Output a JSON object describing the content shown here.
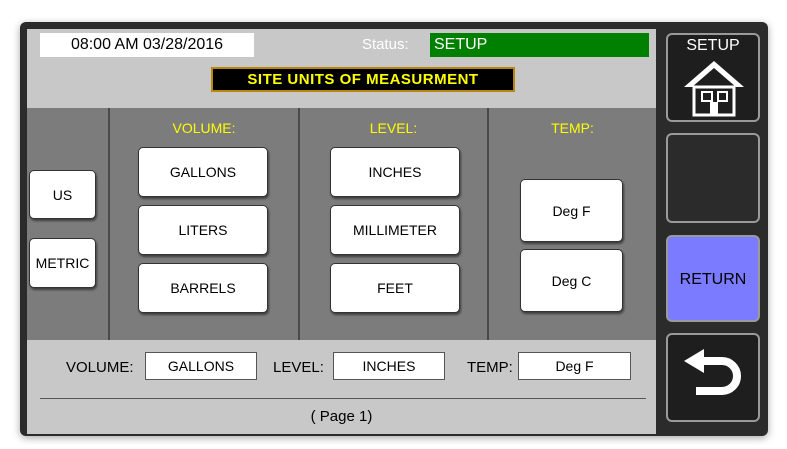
{
  "header": {
    "datetime": "08:00 AM 03/28/2016",
    "status_label": "Status:",
    "status_value": "SETUP",
    "title": "SITE UNITS OF MEASURMENT"
  },
  "systems": {
    "us": "US",
    "metric": "METRIC"
  },
  "volume": {
    "header": "VOLUME:",
    "options": [
      "GALLONS",
      "LITERS",
      "BARRELS"
    ]
  },
  "level": {
    "header": "LEVEL:",
    "options": [
      "INCHES",
      "MILLIMETER",
      "FEET"
    ]
  },
  "temp": {
    "header": "TEMP:",
    "options": [
      "Deg F",
      "Deg C"
    ]
  },
  "summary": {
    "volume_label": "VOLUME:",
    "volume_value": "GALLONS",
    "level_label": "LEVEL:",
    "level_value": "INCHES",
    "temp_label": "TEMP:",
    "temp_value": "Deg F"
  },
  "footer": {
    "page": "( Page 1)"
  },
  "sidebar": {
    "setup_label": "SETUP",
    "setup_icon": "house-icon",
    "return_label": "RETURN",
    "back_icon": "return-arrow-icon"
  },
  "colors": {
    "status_green": "#008000",
    "title_yellow": "#ffff00",
    "return_blue": "#7b7bff"
  }
}
